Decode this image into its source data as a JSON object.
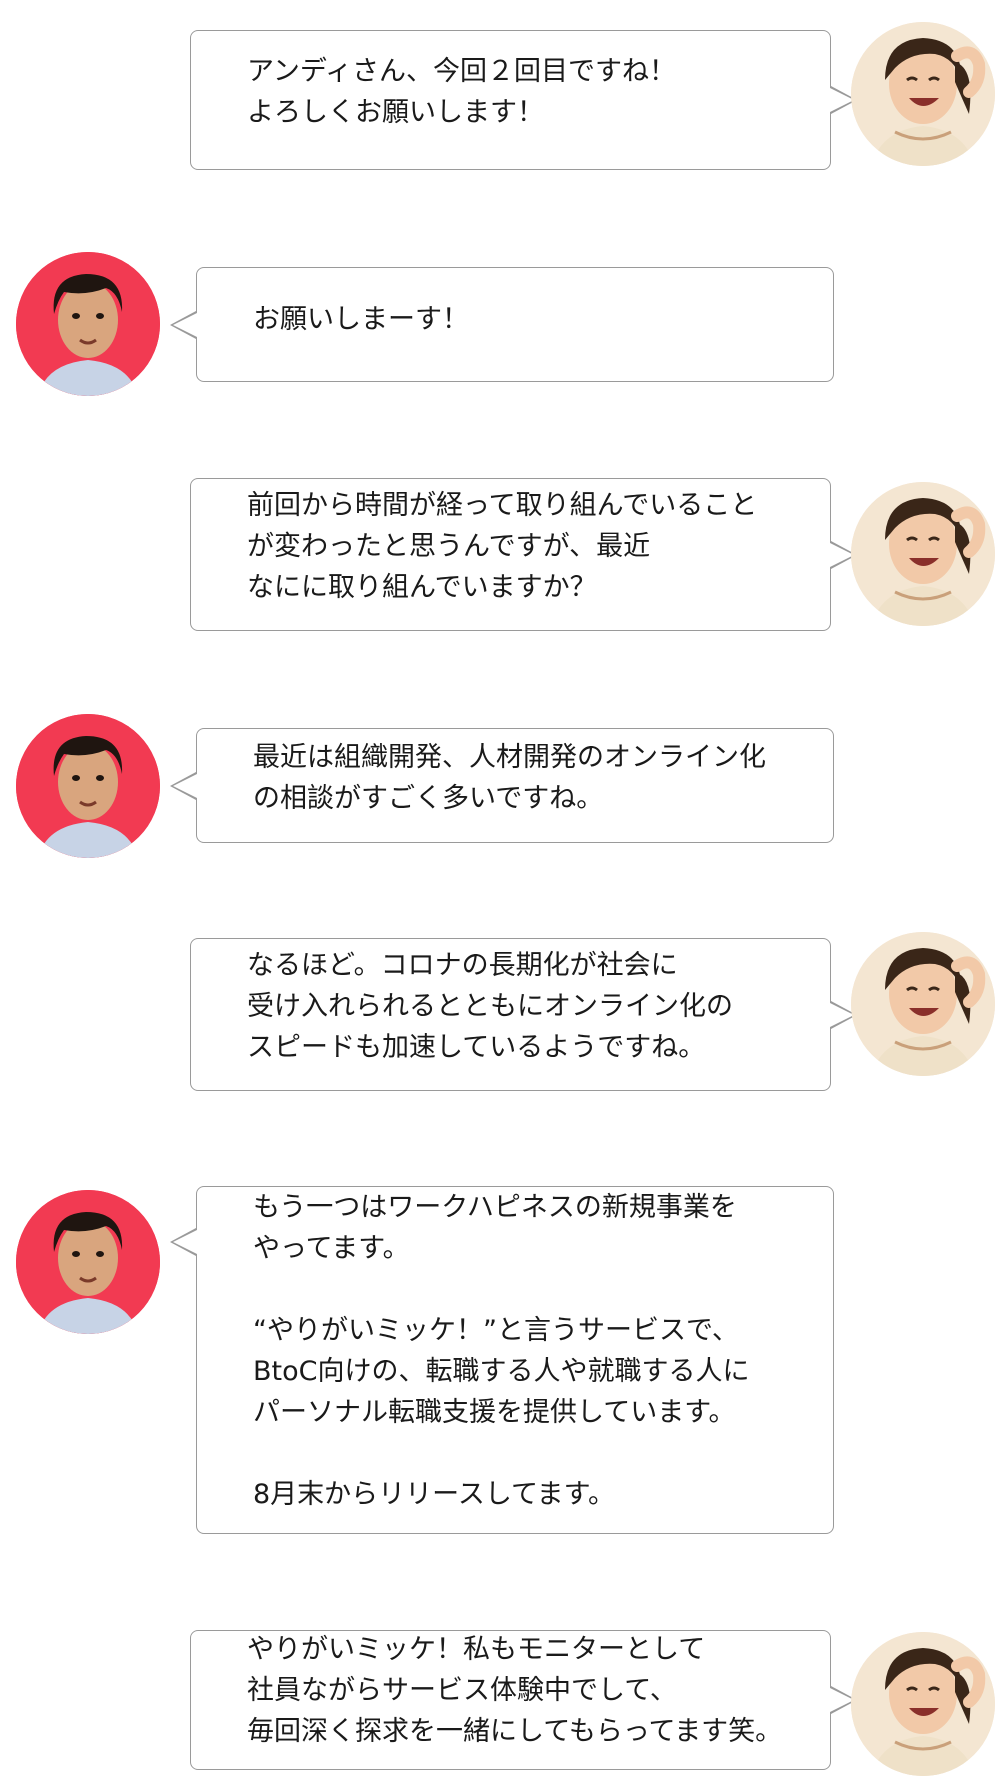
{
  "conversation": {
    "messages": [
      {
        "speaker": "interviewer",
        "text": "アンディさん、今回２回目ですね！\nよろしくお願いします！"
      },
      {
        "speaker": "andy",
        "text": "お願いしまーす！"
      },
      {
        "speaker": "interviewer",
        "text": "前回から時間が経って取り組んでいること\nが変わったと思うんですが、最近\nなにに取り組んでいますか？"
      },
      {
        "speaker": "andy",
        "text": "最近は組織開発、人材開発のオンライン化\nの相談がすごく多いですね。"
      },
      {
        "speaker": "interviewer",
        "text": "なるほど。コロナの長期化が社会に\n受け入れられるとともにオンライン化の\nスピードも加速しているようですね。"
      },
      {
        "speaker": "andy",
        "text": "もう一つはワークハピネスの新規事業を\nやってます。\n\n“やりがいミッケ！”と言うサービスで、\nBtoC向けの、転職する人や就職する人に\nパーソナル転職支援を提供しています。\n\n8月末からリリースしてます。"
      },
      {
        "speaker": "interviewer",
        "text": "やりがいミッケ！私もモニターとして\n社員ながらサービス体験中でして、\n毎回深く探求を一緒にしてもらってます笑。"
      }
    ]
  },
  "colors": {
    "andy_avatar_bg": "#f23a52",
    "interviewer_avatar_bg": "#f4e6d2",
    "bubble_border": "#9a9a9a"
  }
}
